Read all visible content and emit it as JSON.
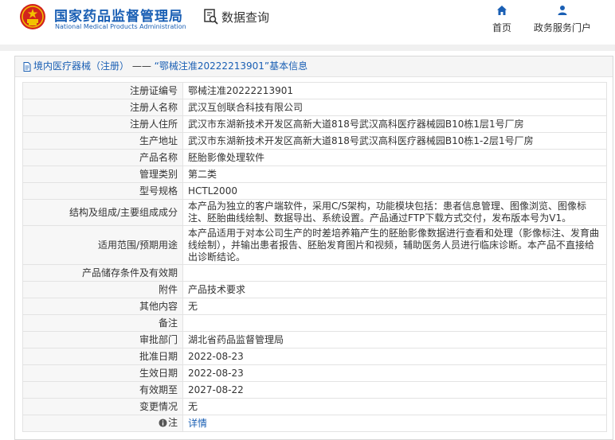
{
  "header": {
    "title_cn": "国家药品监督管理局",
    "title_en": "National Medical Products Administration",
    "data_query": "数据查询",
    "nav": [
      {
        "label": "首页",
        "icon": "home-icon"
      },
      {
        "label": "政务服务门户",
        "icon": "user-icon"
      }
    ]
  },
  "breadcrumb": {
    "category": "境内医疗器械（注册）",
    "separator": "——",
    "subject": "“鄂械注准20222213901”基本信息"
  },
  "table": {
    "rows": [
      {
        "label": "注册证编号",
        "value": "鄂械注准20222213901"
      },
      {
        "label": "注册人名称",
        "value": "武汉互创联合科技有限公司"
      },
      {
        "label": "注册人住所",
        "value": "武汉市东湖新技术开发区高新大道818号武汉高科医疗器械园B10栋1层1号厂房"
      },
      {
        "label": "生产地址",
        "value": "武汉市东湖新技术开发区高新大道818号武汉高科医疗器械园B10栋1-2层1号厂房"
      },
      {
        "label": "产品名称",
        "value": "胚胎影像处理软件"
      },
      {
        "label": "管理类别",
        "value": "第二类"
      },
      {
        "label": "型号规格",
        "value": "HCTL2000"
      },
      {
        "label": "结构及组成/主要组成成分",
        "value": "本产品为独立的客户端软件，采用C/S架构，功能模块包括：患者信息管理、图像浏览、图像标注、胚胎曲线绘制、数据导出、系统设置。产品通过FTP下载方式交付，发布版本号为V1。"
      },
      {
        "label": "适用范围/预期用途",
        "value": "本产品适用于对本公司生产的时差培养箱产生的胚胎影像数据进行查看和处理（影像标注、发育曲线绘制），并输出患者报告、胚胎发育图片和视频，辅助医务人员进行临床诊断。本产品不直接给出诊断结论。"
      },
      {
        "label": "产品储存条件及有效期",
        "value": ""
      },
      {
        "label": "附件",
        "value": "产品技术要求"
      },
      {
        "label": "其他内容",
        "value": "无"
      },
      {
        "label": "备注",
        "value": ""
      },
      {
        "label": "审批部门",
        "value": "湖北省药品监督管理局"
      },
      {
        "label": "批准日期",
        "value": "2022-08-23"
      },
      {
        "label": "生效日期",
        "value": "2022-08-23"
      },
      {
        "label": "有效期至",
        "value": "2027-08-22"
      },
      {
        "label": "变更情况",
        "value": "无"
      }
    ],
    "note": {
      "label": "注",
      "link": "详情"
    }
  },
  "colors": {
    "brand": "#1a5fb4",
    "emblem_red": "#d2241d",
    "emblem_gold": "#f2c200"
  }
}
